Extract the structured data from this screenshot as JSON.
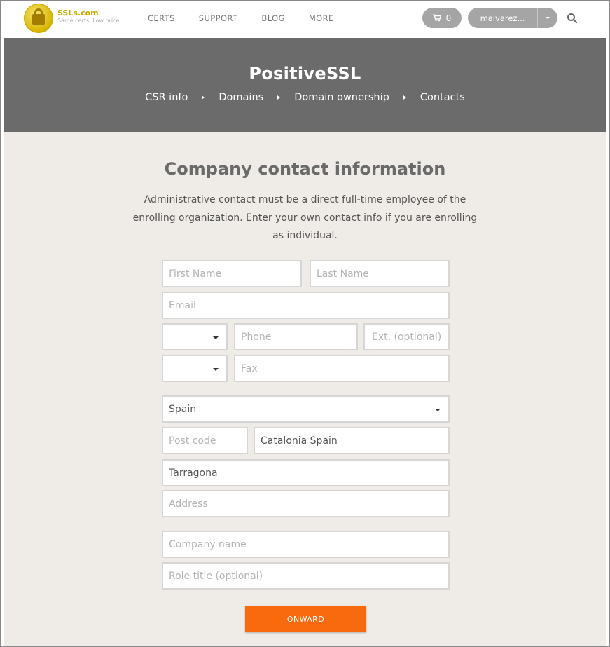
{
  "colors": {
    "banner_bg": "#6b6b6b",
    "main_bg": "#efebe6",
    "accent": "#f96a0e",
    "pill": "#a5a5a5"
  },
  "header": {
    "logo": {
      "name": "SSLs.com",
      "tagline": "Same certs. Low price",
      "icon": "padlock-badge-icon"
    },
    "nav": [
      {
        "label": "CERTS"
      },
      {
        "label": "SUPPORT"
      },
      {
        "label": "BLOG"
      },
      {
        "label": "MORE"
      }
    ],
    "cart": {
      "count": "0",
      "icon": "cart-icon"
    },
    "user": {
      "name": "malvarez...",
      "icon": "caret-down-icon"
    },
    "search_icon": "search-icon"
  },
  "banner": {
    "title": "PositiveSSL",
    "steps": [
      {
        "label": "CSR info"
      },
      {
        "label": "Domains"
      },
      {
        "label": "Domain ownership"
      },
      {
        "label": "Contacts"
      }
    ]
  },
  "form": {
    "title": "Company contact information",
    "description": "Administrative contact must be a direct full-time employee of the enrolling organization. Enter your own contact info if you are enrolling as individual.",
    "first_name": {
      "placeholder": "First Name",
      "value": ""
    },
    "last_name": {
      "placeholder": "Last Name",
      "value": ""
    },
    "email": {
      "placeholder": "Email",
      "value": ""
    },
    "phone_code": {
      "value": ""
    },
    "phone": {
      "placeholder": "Phone",
      "value": ""
    },
    "ext": {
      "placeholder": "Ext. (optional)",
      "value": ""
    },
    "fax_code": {
      "value": ""
    },
    "fax": {
      "placeholder": "Fax",
      "value": ""
    },
    "country": {
      "value": "Spain"
    },
    "postcode": {
      "placeholder": "Post code",
      "value": ""
    },
    "region": {
      "placeholder": "",
      "value": "Catalonia Spain"
    },
    "city": {
      "placeholder": "",
      "value": "Tarragona"
    },
    "address": {
      "placeholder": "Address",
      "value": ""
    },
    "company": {
      "placeholder": "Company name",
      "value": ""
    },
    "role": {
      "placeholder": "Role title (optional)",
      "value": ""
    },
    "submit_label": "ONWARD"
  }
}
